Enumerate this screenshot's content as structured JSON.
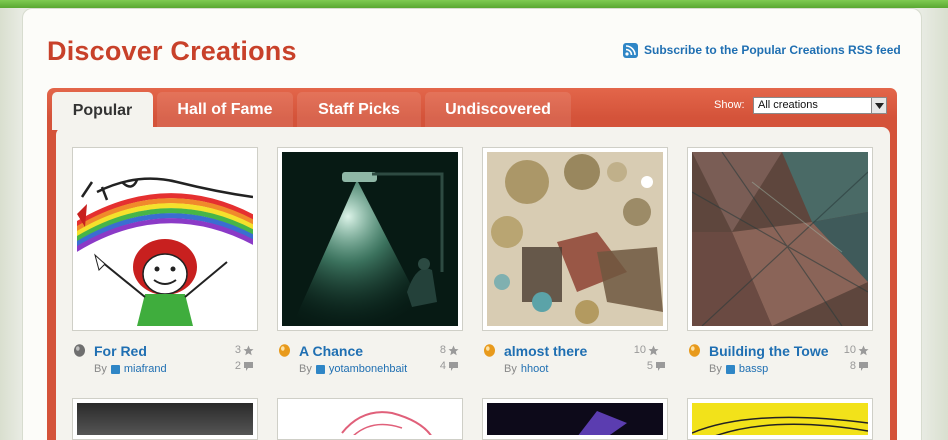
{
  "page": {
    "title": "Discover Creations"
  },
  "rss": {
    "label": "Subscribe to the Popular Creations RSS feed",
    "icon": "rss-icon"
  },
  "tabs": [
    {
      "label": "Popular",
      "active": true
    },
    {
      "label": "Hall of Fame",
      "active": false
    },
    {
      "label": "Staff Picks",
      "active": false
    },
    {
      "label": "Undiscovered",
      "active": false
    }
  ],
  "filter": {
    "label": "Show:",
    "selected": "All creations"
  },
  "items": [
    {
      "title": "For Red",
      "by_label": "By",
      "user": "miafrand",
      "favorites": "3",
      "comments": "2",
      "badge": "gray-egg-icon"
    },
    {
      "title": "A Chance",
      "by_label": "By",
      "user": "yotambonehbait",
      "favorites": "8",
      "comments": "4",
      "badge": "orange-egg-icon"
    },
    {
      "title": "almost there",
      "by_label": "By",
      "user": "hhoot",
      "favorites": "10",
      "comments": "5",
      "badge": "orange-egg-icon"
    },
    {
      "title": "Building the Tower",
      "by_label": "By",
      "user": "bassp",
      "favorites": "10",
      "comments": "8",
      "badge": "orange-egg-icon"
    }
  ],
  "colors": {
    "accent": "#c8412a",
    "link": "#1f6fb2",
    "tab_bar": "#d4533a",
    "green_bar": "#6bbf3f"
  }
}
